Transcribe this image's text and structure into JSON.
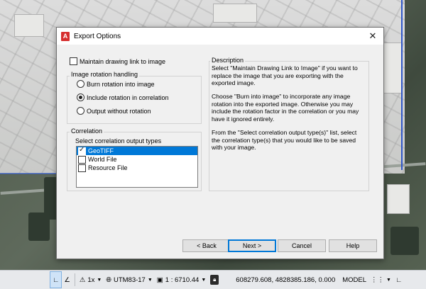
{
  "dialog": {
    "title": "Export Options",
    "maintain_link_label": "Maintain drawing link to image",
    "rotation": {
      "group_label": "Image rotation handling",
      "options": [
        {
          "label": "Burn rotation into image",
          "selected": false
        },
        {
          "label": "Include rotation in correlation",
          "selected": true
        },
        {
          "label": "Output without rotation",
          "selected": false
        }
      ]
    },
    "correlation": {
      "group_label": "Correlation",
      "list_label": "Select correlation output types",
      "items": [
        {
          "label": "GeoTIFF",
          "checked": true,
          "selected": true
        },
        {
          "label": "World File",
          "checked": false,
          "selected": false
        },
        {
          "label": "Resource File",
          "checked": false,
          "selected": false
        }
      ]
    },
    "description": {
      "title": "Description",
      "paragraphs": [
        "Select \"Maintain Drawing Link to Image\" if you want to replace the image that you are exporting with the exported image.",
        "Choose \"Burn into image\" to incorporate any image rotation into the exported image. Otherwise you may include the rotation factor in the correlation or you may have it ignored entirely.",
        "From the \"Select correlation output type(s)\" list, select the correlation type(s) that you would like to be saved with your image."
      ]
    },
    "buttons": {
      "back": "< Back",
      "next": "Next >",
      "cancel": "Cancel",
      "help": "Help"
    }
  },
  "statusbar": {
    "scale_factor": "1x",
    "coordinate_system": "UTM83-17",
    "scale": "1 : 6710.44",
    "coordinates": "608279.608, 4828385.186, 0.000",
    "model_label": "MODEL"
  },
  "colors": {
    "selection": "#0078d7",
    "app_icon": "#d62e2e"
  }
}
